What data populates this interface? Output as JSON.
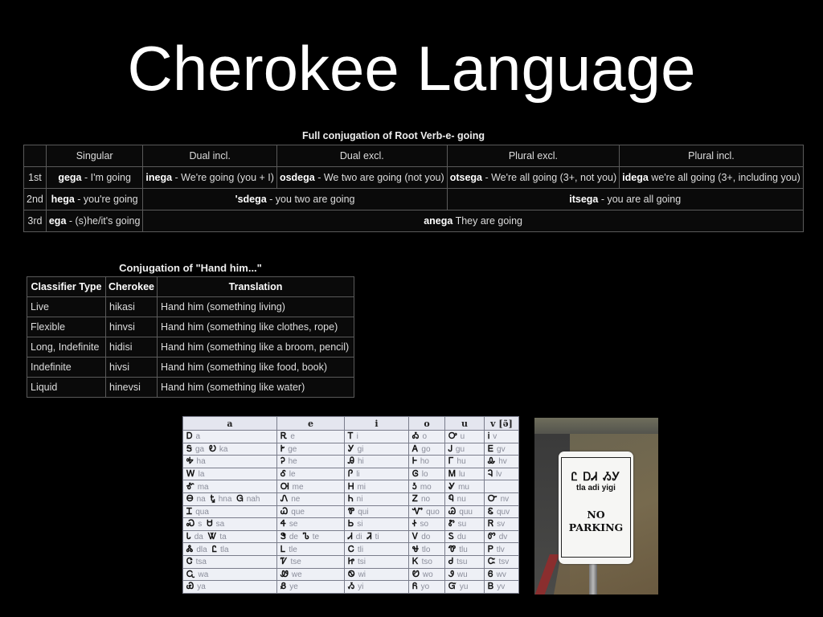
{
  "title": "Cherokee Language",
  "conjugation_table": {
    "caption": "Full conjugation of Root Verb-e- going",
    "headers": [
      "",
      "Singular",
      "Dual incl.",
      "Dual excl.",
      "Plural excl.",
      "Plural incl."
    ],
    "row1": {
      "person": "1st",
      "singular": {
        "word": "gega",
        "text": " - I'm going"
      },
      "dual_incl": {
        "word": "inega",
        "text": " - We're going (you + I)"
      },
      "dual_excl": {
        "word": "osdega",
        "text": " - We two are going (not you)"
      },
      "plural_excl": {
        "word": "otsega",
        "text": " - We're all going (3+, not you)"
      },
      "plural_incl": {
        "word": "idega",
        "text": " we're all going (3+, including you)"
      }
    },
    "row2": {
      "person": "2nd",
      "singular": {
        "word": "hega",
        "text": " - you're going"
      },
      "dual": {
        "word": "'sdega",
        "text": " - you two are going"
      },
      "plural": {
        "word": "itsega",
        "text": " - you are all going"
      }
    },
    "row3": {
      "person": "3rd",
      "singular": {
        "word": "ega",
        "text": " - (s)he/it's going"
      },
      "rest": {
        "word": "anega",
        "text": " They are going"
      }
    }
  },
  "hand_table": {
    "caption": "Conjugation of \"Hand him...\"",
    "headers": [
      "Classifier Type",
      "Cherokee",
      "Translation"
    ],
    "rows": [
      [
        "Live",
        "hikasi",
        "Hand him (something living)"
      ],
      [
        "Flexible",
        "hinvsi",
        "Hand him (something like clothes, rope)"
      ],
      [
        "Long, Indefinite",
        "hidisi",
        "Hand him (something like a broom, pencil)"
      ],
      [
        "Indefinite",
        "hivsi",
        "Hand him (something like food, book)"
      ],
      [
        "Liquid",
        "hinevsi",
        "Hand him (something like water)"
      ]
    ]
  },
  "syllabary": {
    "headers": [
      "a",
      "e",
      "i",
      "o",
      "u",
      "v [ə̃]"
    ],
    "rows": [
      [
        [
          [
            "Ꭰ",
            "a"
          ]
        ],
        [
          [
            "Ꭱ",
            "e"
          ]
        ],
        [
          [
            "Ꭲ",
            "i"
          ]
        ],
        [
          [
            "Ꭳ",
            "o"
          ]
        ],
        [
          [
            "Ꭴ",
            "u"
          ]
        ],
        [
          [
            "Ꭵ",
            "v"
          ]
        ]
      ],
      [
        [
          [
            "Ꭶ",
            "ga"
          ],
          [
            "Ꭷ",
            "ka"
          ]
        ],
        [
          [
            "Ꭸ",
            "ge"
          ]
        ],
        [
          [
            "Ꭹ",
            "gi"
          ]
        ],
        [
          [
            "Ꭺ",
            "go"
          ]
        ],
        [
          [
            "Ꭻ",
            "gu"
          ]
        ],
        [
          [
            "Ꭼ",
            "gv"
          ]
        ]
      ],
      [
        [
          [
            "Ꭽ",
            "ha"
          ]
        ],
        [
          [
            "Ꭾ",
            "he"
          ]
        ],
        [
          [
            "Ꭿ",
            "hi"
          ]
        ],
        [
          [
            "Ꮀ",
            "ho"
          ]
        ],
        [
          [
            "Ꮁ",
            "hu"
          ]
        ],
        [
          [
            "Ꮂ",
            "hv"
          ]
        ]
      ],
      [
        [
          [
            "Ꮃ",
            "la"
          ]
        ],
        [
          [
            "Ꮄ",
            "le"
          ]
        ],
        [
          [
            "Ꮅ",
            "li"
          ]
        ],
        [
          [
            "Ꮆ",
            "lo"
          ]
        ],
        [
          [
            "Ꮇ",
            "lu"
          ]
        ],
        [
          [
            "Ꮈ",
            "lv"
          ]
        ]
      ],
      [
        [
          [
            "Ꮉ",
            "ma"
          ]
        ],
        [
          [
            "Ꮊ",
            "me"
          ]
        ],
        [
          [
            "Ꮋ",
            "mi"
          ]
        ],
        [
          [
            "Ꮌ",
            "mo"
          ]
        ],
        [
          [
            "Ꮍ",
            "mu"
          ]
        ],
        []
      ],
      [
        [
          [
            "Ꮎ",
            "na"
          ],
          [
            "Ꮏ",
            "hna"
          ],
          [
            "Ꮐ",
            "nah"
          ]
        ],
        [
          [
            "Ꮑ",
            "ne"
          ]
        ],
        [
          [
            "Ꮒ",
            "ni"
          ]
        ],
        [
          [
            "Ꮓ",
            "no"
          ]
        ],
        [
          [
            "Ꮔ",
            "nu"
          ]
        ],
        [
          [
            "Ꮕ",
            "nv"
          ]
        ]
      ],
      [
        [
          [
            "Ꮖ",
            "qua"
          ]
        ],
        [
          [
            "Ꮗ",
            "que"
          ]
        ],
        [
          [
            "Ꮘ",
            "qui"
          ]
        ],
        [
          [
            "Ꮙ",
            "quo"
          ]
        ],
        [
          [
            "Ꮚ",
            "quu"
          ]
        ],
        [
          [
            "Ꮛ",
            "quv"
          ]
        ]
      ],
      [
        [
          [
            "Ꮝ",
            "s"
          ],
          [
            "Ꮜ",
            "sa"
          ]
        ],
        [
          [
            "Ꮞ",
            "se"
          ]
        ],
        [
          [
            "Ꮟ",
            "si"
          ]
        ],
        [
          [
            "Ꮠ",
            "so"
          ]
        ],
        [
          [
            "Ꮡ",
            "su"
          ]
        ],
        [
          [
            "Ꮢ",
            "sv"
          ]
        ]
      ],
      [
        [
          [
            "Ꮣ",
            "da"
          ],
          [
            "Ꮤ",
            "ta"
          ]
        ],
        [
          [
            "Ꮥ",
            "de"
          ],
          [
            "Ꮦ",
            "te"
          ]
        ],
        [
          [
            "Ꮧ",
            "di"
          ],
          [
            "Ꮨ",
            "ti"
          ]
        ],
        [
          [
            "Ꮩ",
            "do"
          ]
        ],
        [
          [
            "Ꮪ",
            "du"
          ]
        ],
        [
          [
            "Ꮫ",
            "dv"
          ]
        ]
      ],
      [
        [
          [
            "Ꮬ",
            "dla"
          ],
          [
            "Ꮭ",
            "tla"
          ]
        ],
        [
          [
            "Ꮮ",
            "tle"
          ]
        ],
        [
          [
            "Ꮯ",
            "tli"
          ]
        ],
        [
          [
            "Ꮰ",
            "tlo"
          ]
        ],
        [
          [
            "Ꮱ",
            "tlu"
          ]
        ],
        [
          [
            "Ꮲ",
            "tlv"
          ]
        ]
      ],
      [
        [
          [
            "Ꮳ",
            "tsa"
          ]
        ],
        [
          [
            "Ꮴ",
            "tse"
          ]
        ],
        [
          [
            "Ꮵ",
            "tsi"
          ]
        ],
        [
          [
            "Ꮶ",
            "tso"
          ]
        ],
        [
          [
            "Ꮷ",
            "tsu"
          ]
        ],
        [
          [
            "Ꮸ",
            "tsv"
          ]
        ]
      ],
      [
        [
          [
            "Ꮹ",
            "wa"
          ]
        ],
        [
          [
            "Ꮺ",
            "we"
          ]
        ],
        [
          [
            "Ꮻ",
            "wi"
          ]
        ],
        [
          [
            "Ꮼ",
            "wo"
          ]
        ],
        [
          [
            "Ꮽ",
            "wu"
          ]
        ],
        [
          [
            "Ꮾ",
            "wv"
          ]
        ]
      ],
      [
        [
          [
            "Ꮿ",
            "ya"
          ]
        ],
        [
          [
            "Ᏸ",
            "ye"
          ]
        ],
        [
          [
            "Ᏹ",
            "yi"
          ]
        ],
        [
          [
            "Ᏺ",
            "yo"
          ]
        ],
        [
          [
            "Ᏻ",
            "yu"
          ]
        ],
        [
          [
            "Ᏼ",
            "yv"
          ]
        ]
      ]
    ]
  },
  "sign_photo": {
    "cherokee": "Ꮭ ᎠᏗ ᏱᎩ",
    "latin": "tla adi yigi",
    "line1": "NO",
    "line2": "PARKING"
  }
}
